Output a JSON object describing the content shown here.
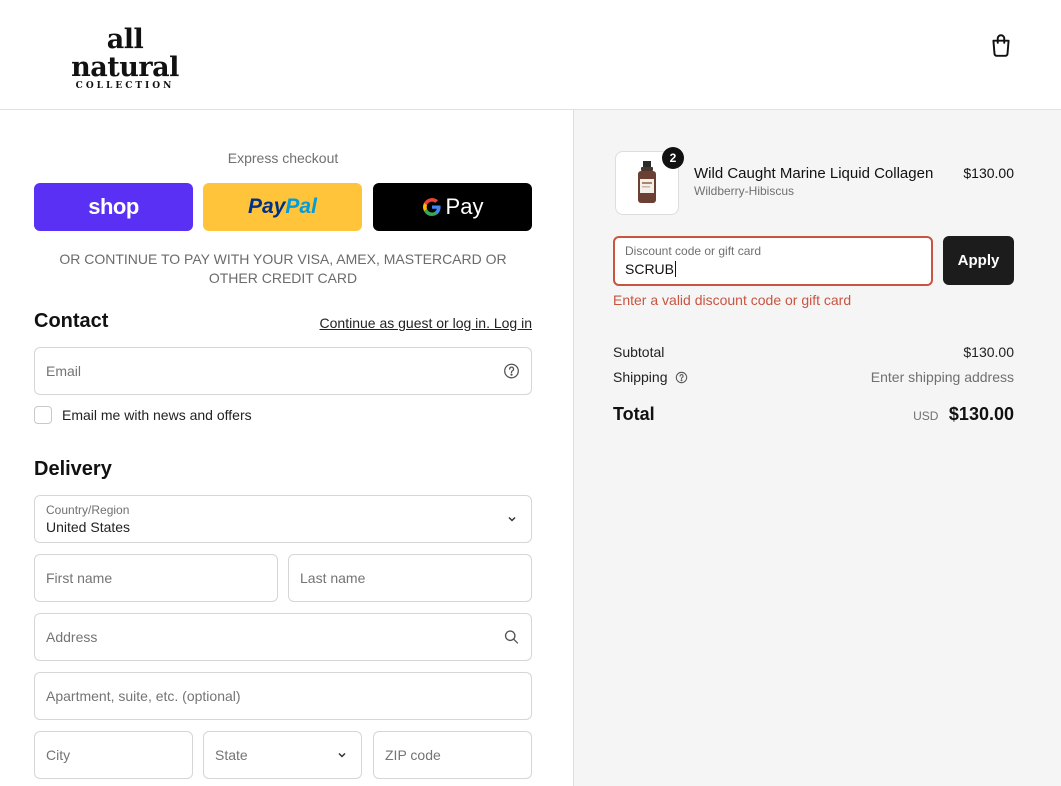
{
  "header": {
    "logo_main": "all natural",
    "logo_sub": "COLLECTION",
    "cart_icon": "shopping-bag-icon"
  },
  "express": {
    "label": "Express checkout",
    "shop_label": "shop",
    "paypal_label_1": "Pay",
    "paypal_label_2": "Pal",
    "gpay_g": "G",
    "gpay_label": "Pay",
    "or_text": "OR CONTINUE TO PAY WITH YOUR VISA, AMEX, MASTERCARD OR OTHER CREDIT CARD"
  },
  "contact": {
    "title": "Contact",
    "login_text": "Continue as guest or log in. Log in",
    "email_placeholder": "Email",
    "newsletter_label": "Email me with news and offers"
  },
  "delivery": {
    "title": "Delivery",
    "country_label": "Country/Region",
    "country_value": "United States",
    "first_name_placeholder": "First name",
    "last_name_placeholder": "Last name",
    "address_placeholder": "Address",
    "apartment_placeholder": "Apartment, suite, etc. (optional)",
    "city_placeholder": "City",
    "state_label": "State",
    "zip_placeholder": "ZIP code"
  },
  "order": {
    "quantity": "2",
    "product_name": "Wild Caught Marine Liquid Collagen",
    "product_variant": "Wildberry-Hibiscus",
    "product_price": "$130.00",
    "discount_label": "Discount code or gift card",
    "discount_value": "SCRUB",
    "apply_label": "Apply",
    "error_text": "Enter a valid discount code or gift card",
    "subtotal_label": "Subtotal",
    "subtotal_value": "$130.00",
    "shipping_label": "Shipping",
    "shipping_value": "Enter shipping address",
    "total_label": "Total",
    "currency": "USD",
    "total_value": "$130.00"
  },
  "colors": {
    "shop": "#5a31f4",
    "paypal": "#ffc439",
    "error": "#c9543f"
  }
}
